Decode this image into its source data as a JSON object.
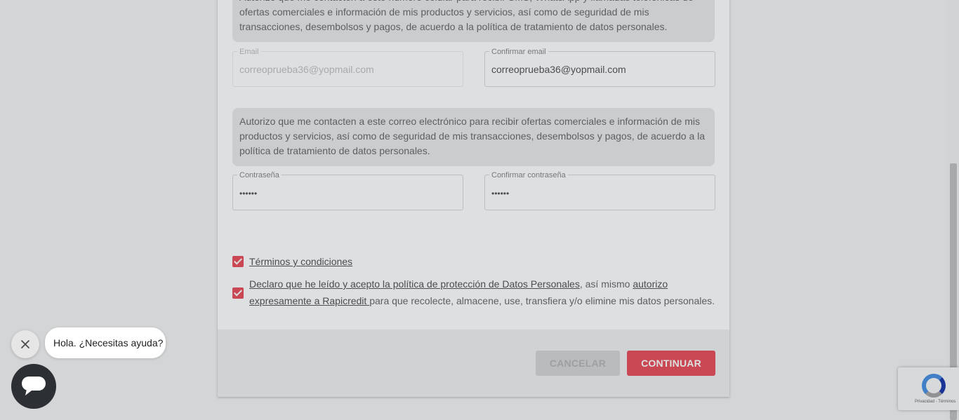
{
  "form": {
    "phone_consent_text": "Autorizo que me contacten a este número celular para recibir SMS, WhatsApp y llamadas telefónicas de ofertas comerciales e información de mis productos y servicios, así como de seguridad de mis transacciones, desembolsos y pagos, de acuerdo a la política de tratamiento de datos personales.",
    "email": {
      "label": "Email",
      "value": "correoprueba36@yopmail.com"
    },
    "confirm_email": {
      "label": "Confirmar email",
      "value": "correoprueba36@yopmail.com"
    },
    "email_consent_text": "Autorizo que me contacten a este correo electrónico para recibir ofertas comerciales e información de mis productos y servicios, así como de seguridad de mis transacciones, desembolsos y pagos, de acuerdo a la política de tratamiento de datos personales.",
    "password": {
      "label": "Contraseña",
      "value": "••••••"
    },
    "confirm_password": {
      "label": "Confirmar contraseña",
      "value": "••••••"
    },
    "terms_link": " Términos y condiciones ",
    "declaration": {
      "link1": " Declaro que he leído y acepto la política de protección de Datos Personales",
      "text1": ", así mismo ",
      "link2": "autorizo expresamente a Rapicredit ",
      "text2": "para que recolecte, almacene, use, transfiera y/o elimine mis datos personales."
    }
  },
  "actions": {
    "cancel": "CANCELAR",
    "continue": "CONTINUAR"
  },
  "chat": {
    "greeting": "Hola. ¿Necesitas ayuda?",
    "close_icon": "close-icon",
    "chat_icon": "chat-bubble-icon"
  },
  "recaptcha": {
    "links": "Privacidad - Términos"
  },
  "colors": {
    "accent": "#e8505b",
    "chat_button": "#2c2f33"
  }
}
